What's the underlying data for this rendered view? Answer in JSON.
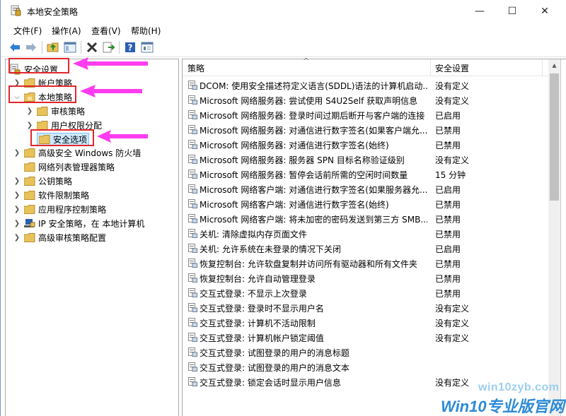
{
  "window": {
    "title": "本地安全策略",
    "minimize_glyph": "—",
    "maximize_glyph": "☐",
    "close_glyph": "✕"
  },
  "menu": [
    "文件(F)",
    "操作(A)",
    "查看(V)",
    "帮助(H)"
  ],
  "toolbar": {
    "icons": [
      "back-arrow-icon",
      "forward-arrow-icon",
      "up-folder-icon",
      "show-hide-tree-icon",
      "delete-icon",
      "export-list-icon",
      "help-icon",
      "properties-icon"
    ]
  },
  "tree": {
    "root": "安全设置",
    "items": [
      {
        "label": "帐户策略",
        "level": 1,
        "expanded": false
      },
      {
        "label": "本地策略",
        "level": 1,
        "expanded": true
      },
      {
        "label": "审核策略",
        "level": 2,
        "expanded": false
      },
      {
        "label": "用户权限分配",
        "level": 2,
        "expanded": false
      },
      {
        "label": "安全选项",
        "level": 2,
        "selected": true
      },
      {
        "label": "高级安全 Windows 防火墙",
        "level": 1,
        "expanded": false
      },
      {
        "label": "网络列表管理器策略",
        "level": 1
      },
      {
        "label": "公钥策略",
        "level": 1,
        "expanded": false
      },
      {
        "label": "软件限制策略",
        "level": 1,
        "expanded": false
      },
      {
        "label": "应用程序控制策略",
        "level": 1,
        "expanded": false
      },
      {
        "label": "IP 安全策略，在 本地计算机",
        "level": 1,
        "expanded": false
      },
      {
        "label": "高级审核策略配置",
        "level": 1,
        "expanded": false
      }
    ]
  },
  "list": {
    "columns": [
      "策略",
      "安全设置"
    ],
    "rows": [
      {
        "policy": "DCOM: 使用安全描述符定义语言(SDDL)语法的计算机启动...",
        "setting": "没有定义"
      },
      {
        "policy": "Microsoft 网络服务器: 尝试使用 S4U2Self 获取声明信息",
        "setting": "没有定义"
      },
      {
        "policy": "Microsoft 网络服务器: 登录时间过期后断开与客户端的连接",
        "setting": "已启用"
      },
      {
        "policy": "Microsoft 网络服务器: 对通信进行数字签名(如果客户端允...",
        "setting": "已禁用"
      },
      {
        "policy": "Microsoft 网络服务器: 对通信进行数字签名(始终)",
        "setting": "已禁用"
      },
      {
        "policy": "Microsoft 网络服务器: 服务器 SPN 目标名称验证级别",
        "setting": "没有定义"
      },
      {
        "policy": "Microsoft 网络服务器: 暂停会话前所需的空闲时间数量",
        "setting": "15 分钟"
      },
      {
        "policy": "Microsoft 网络客户端: 对通信进行数字签名(如果服务器允...",
        "setting": "已启用"
      },
      {
        "policy": "Microsoft 网络客户端: 对通信进行数字签名(始终)",
        "setting": "已禁用"
      },
      {
        "policy": "Microsoft 网络客户端: 将未加密的密码发送到第三方 SMB...",
        "setting": "已禁用"
      },
      {
        "policy": "关机: 清除虚拟内存页面文件",
        "setting": "已禁用"
      },
      {
        "policy": "关机: 允许系统在未登录的情况下关闭",
        "setting": "已启用"
      },
      {
        "policy": "恢复控制台: 允许软盘复制并访问所有驱动器和所有文件夹",
        "setting": "已禁用"
      },
      {
        "policy": "恢复控制台: 允许自动管理登录",
        "setting": "已禁用"
      },
      {
        "policy": "交互式登录: 不显示上次登录",
        "setting": "已禁用"
      },
      {
        "policy": "交互式登录: 登录时不显示用户名",
        "setting": "没有定义"
      },
      {
        "policy": "交互式登录: 计算机不活动限制",
        "setting": "没有定义"
      },
      {
        "policy": "交互式登录: 计算机帐户锁定阈值",
        "setting": "没有定义"
      },
      {
        "policy": "交互式登录: 试图登录的用户的消息标题",
        "setting": ""
      },
      {
        "policy": "交互式登录: 试图登录的用户的消息文本",
        "setting": ""
      },
      {
        "policy": "交互式登录: 锁定会话时显示用户信息",
        "setting": "没有定义"
      }
    ]
  },
  "watermark": {
    "url": "win10zyb.com",
    "brand": "Win10专业版官网"
  },
  "colors": {
    "annotation_red": "#e3262b",
    "annotation_magenta": "#ff3cf0",
    "selection": "#cce8ff",
    "folder": "#e8c25a"
  }
}
